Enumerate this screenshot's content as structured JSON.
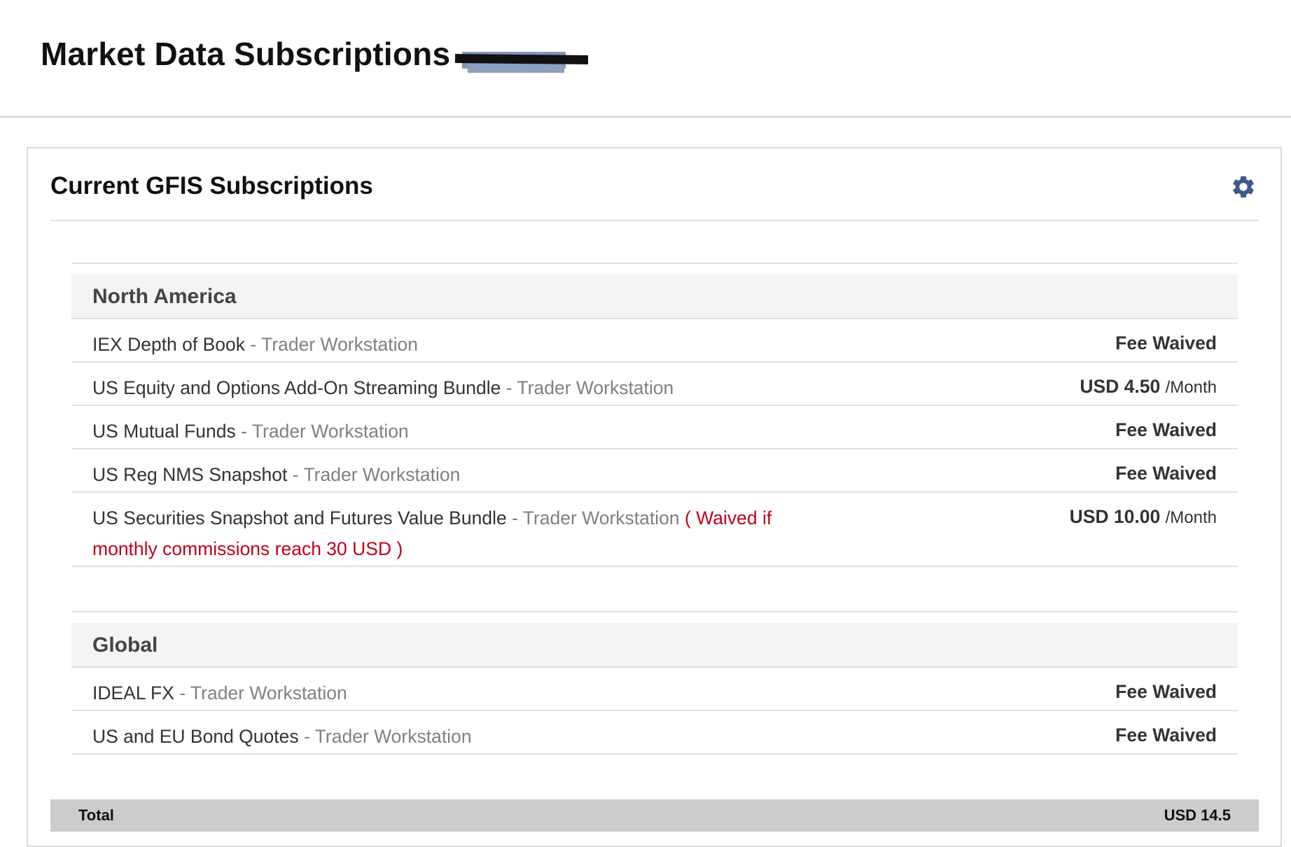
{
  "header": {
    "title": "Market Data Subscriptions"
  },
  "panel": {
    "title": "Current GFIS Subscriptions",
    "settings_icon": "gear-icon",
    "accent_color": "#3d5a8a"
  },
  "regions": [
    {
      "name": "North America",
      "items": [
        {
          "name": "IEX Depth of Book",
          "separator": " - ",
          "platform": "Trader Workstation",
          "note": "",
          "fee": "Fee Waived",
          "unit": ""
        },
        {
          "name": "US Equity and Options Add-On Streaming Bundle",
          "separator": " - ",
          "platform": "Trader Workstation",
          "note": "",
          "fee": "USD 4.50",
          "unit": "/Month"
        },
        {
          "name": "US Mutual Funds",
          "separator": " - ",
          "platform": "Trader Workstation",
          "note": "",
          "fee": "Fee Waived",
          "unit": ""
        },
        {
          "name": "US Reg NMS Snapshot",
          "separator": " - ",
          "platform": "Trader Workstation",
          "note": "",
          "fee": "Fee Waived",
          "unit": ""
        },
        {
          "name": "US Securities Snapshot and Futures Value Bundle",
          "separator": " - ",
          "platform": "Trader Workstation",
          "note": "( Waived if monthly commissions reach 30 USD )",
          "fee": "USD 10.00",
          "unit": "/Month"
        }
      ]
    },
    {
      "name": "Global",
      "items": [
        {
          "name": "IDEAL FX",
          "separator": " - ",
          "platform": "Trader Workstation",
          "note": "",
          "fee": "Fee Waived",
          "unit": ""
        },
        {
          "name": "US and EU Bond Quotes",
          "separator": " - ",
          "platform": "Trader Workstation",
          "note": "",
          "fee": "Fee Waived",
          "unit": ""
        }
      ]
    }
  ],
  "total": {
    "label": "Total",
    "value": "USD 14.5"
  },
  "colors": {
    "note": "#c0001a",
    "platform": "#808080",
    "total_bar": "#cccccc"
  }
}
